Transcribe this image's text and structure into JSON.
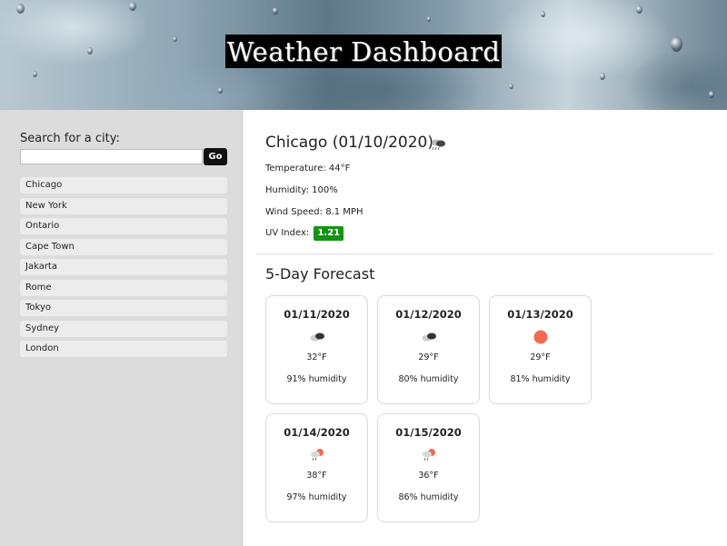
{
  "header": {
    "title": "Weather Dashboard"
  },
  "sidebar": {
    "search_label": "Search for a city:",
    "search_value": "",
    "go_label": "Go",
    "cities": [
      "Chicago",
      "New York",
      "Ontario",
      "Cape Town",
      "Jakarta",
      "Rome",
      "Tokyo",
      "Sydney",
      "London"
    ]
  },
  "current": {
    "heading": "Chicago (01/10/2020)",
    "icon": "rain-cloud-icon",
    "temperature": "Temperature: 44°F",
    "humidity": "Humidity: 100%",
    "wind": "Wind Speed: 8.1 MPH",
    "uv_label": "UV Index:",
    "uv_value": "1.21",
    "uv_color": "#149414"
  },
  "forecast": {
    "title": "5-Day Forecast",
    "days": [
      {
        "date": "01/11/2020",
        "icon": "broken-clouds-icon",
        "temp": "32°F",
        "humidity": "91% humidity"
      },
      {
        "date": "01/12/2020",
        "icon": "broken-clouds-icon",
        "temp": "29°F",
        "humidity": "80% humidity"
      },
      {
        "date": "01/13/2020",
        "icon": "sun-icon",
        "temp": "29°F",
        "humidity": "81% humidity"
      },
      {
        "date": "01/14/2020",
        "icon": "sun-rain-icon",
        "temp": "38°F",
        "humidity": "97% humidity"
      },
      {
        "date": "01/15/2020",
        "icon": "sun-rain-icon",
        "temp": "36°F",
        "humidity": "86% humidity"
      }
    ]
  }
}
